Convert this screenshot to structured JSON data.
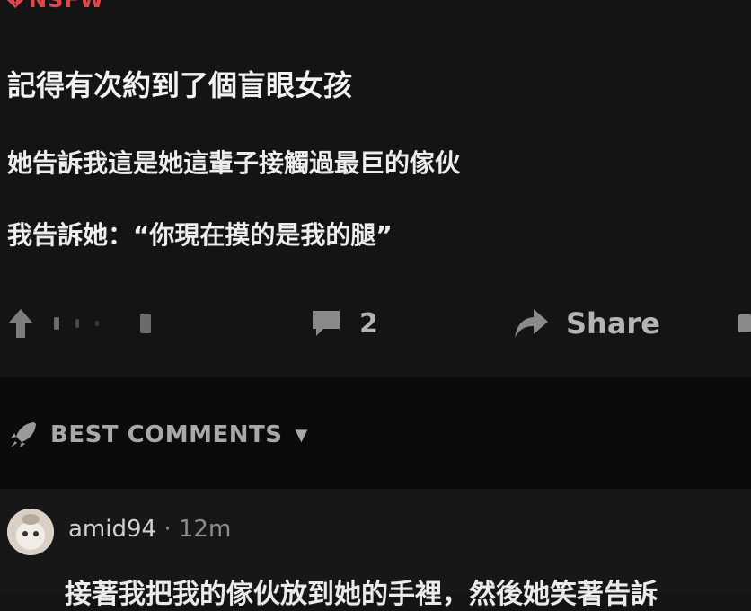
{
  "post": {
    "tag": "NSFW",
    "title": "記得有次約到了個盲眼女孩",
    "lines": [
      "她告訴我這是她這輩子接觸過最巨的傢伙",
      "我告訴她：“你現在摸的是我的腿”"
    ]
  },
  "actions": {
    "comment_count": "2",
    "share_label": "Share"
  },
  "comments_section": {
    "sort_label": "BEST COMMENTS"
  },
  "comment": {
    "username": "amid94",
    "separator": "·",
    "time": "12m",
    "text": "接著我把我的傢伙放到她的手裡，然後她笑著告訴"
  }
}
